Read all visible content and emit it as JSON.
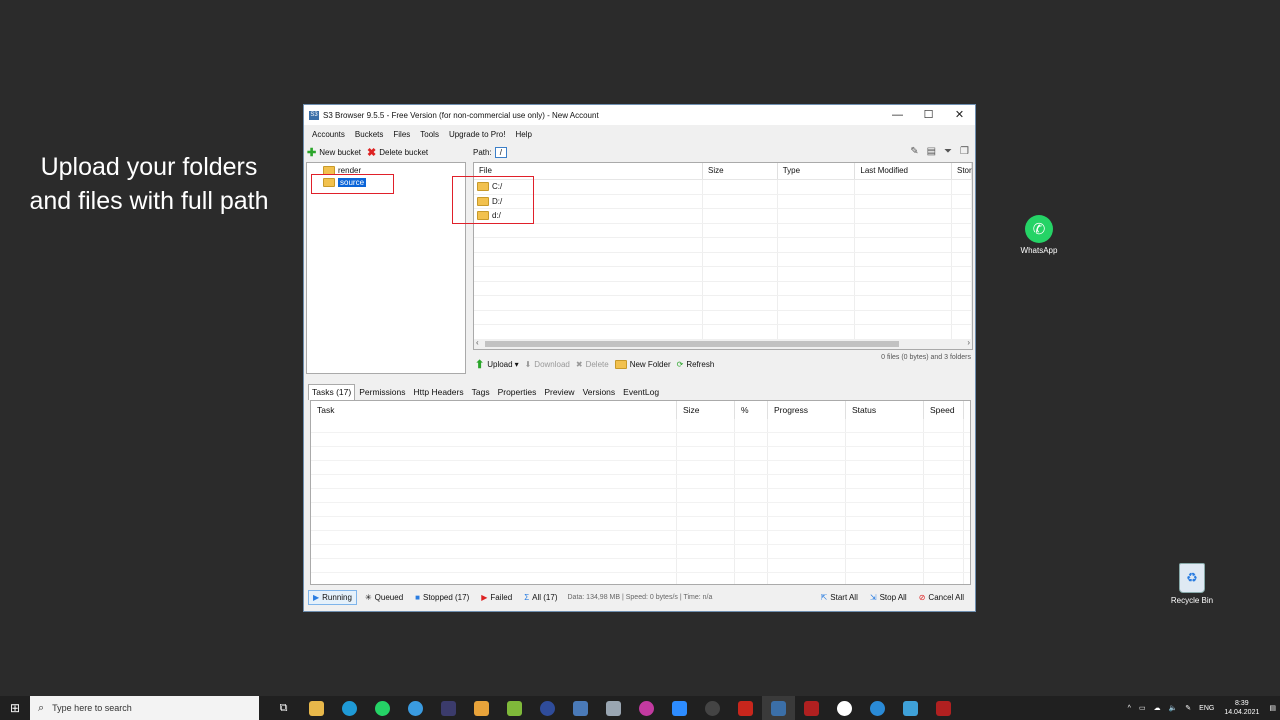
{
  "caption": {
    "line1": "Upload your folders",
    "line2": "and files with full path"
  },
  "desktop": {
    "whatsapp": "WhatsApp",
    "recycle_bin": "Recycle Bin"
  },
  "window": {
    "title": "S3 Browser 9.5.5 - Free Version (for non-commercial use only) - New Account",
    "controls": {
      "minimize": "—",
      "maximize": "☐",
      "close": "✕"
    },
    "menu": [
      "Accounts",
      "Buckets",
      "Files",
      "Tools",
      "Upgrade to Pro!",
      "Help"
    ],
    "bucket_toolbar": {
      "new_bucket": "New bucket",
      "delete_bucket": "Delete bucket"
    },
    "buckets": [
      {
        "name": "render"
      },
      {
        "name": "source",
        "selected": true
      }
    ],
    "path": {
      "label": "Path:",
      "value": "/"
    },
    "file_columns": [
      "File",
      "Size",
      "Type",
      "Last Modified",
      "Stor"
    ],
    "files": [
      "C:/",
      "D:/",
      "d:/"
    ],
    "file_toolbar": {
      "upload": "Upload",
      "download": "Download",
      "delete": "Delete",
      "new_folder": "New Folder",
      "refresh": "Refresh"
    },
    "file_status": "0 files (0 bytes) and 3 folders",
    "tabs": [
      "Tasks (17)",
      "Permissions",
      "Http Headers",
      "Tags",
      "Properties",
      "Preview",
      "Versions",
      "EventLog"
    ],
    "task_columns": [
      "Task",
      "Size",
      "%",
      "Progress",
      "Status",
      "Speed"
    ],
    "task_filters": {
      "running": "Running",
      "queued": "Queued",
      "stopped": "Stopped (17)",
      "failed": "Failed",
      "all": "All (17)"
    },
    "task_info": "Data: 134,98 MB | Speed: 0 bytes/s | Time: n/a",
    "task_actions": {
      "start_all": "Start All",
      "stop_all": "Stop All",
      "cancel_all": "Cancel All"
    }
  },
  "taskbar": {
    "search_placeholder": "Type here to search",
    "language": "ENG",
    "time": "8:39",
    "date": "14.04.2021"
  }
}
